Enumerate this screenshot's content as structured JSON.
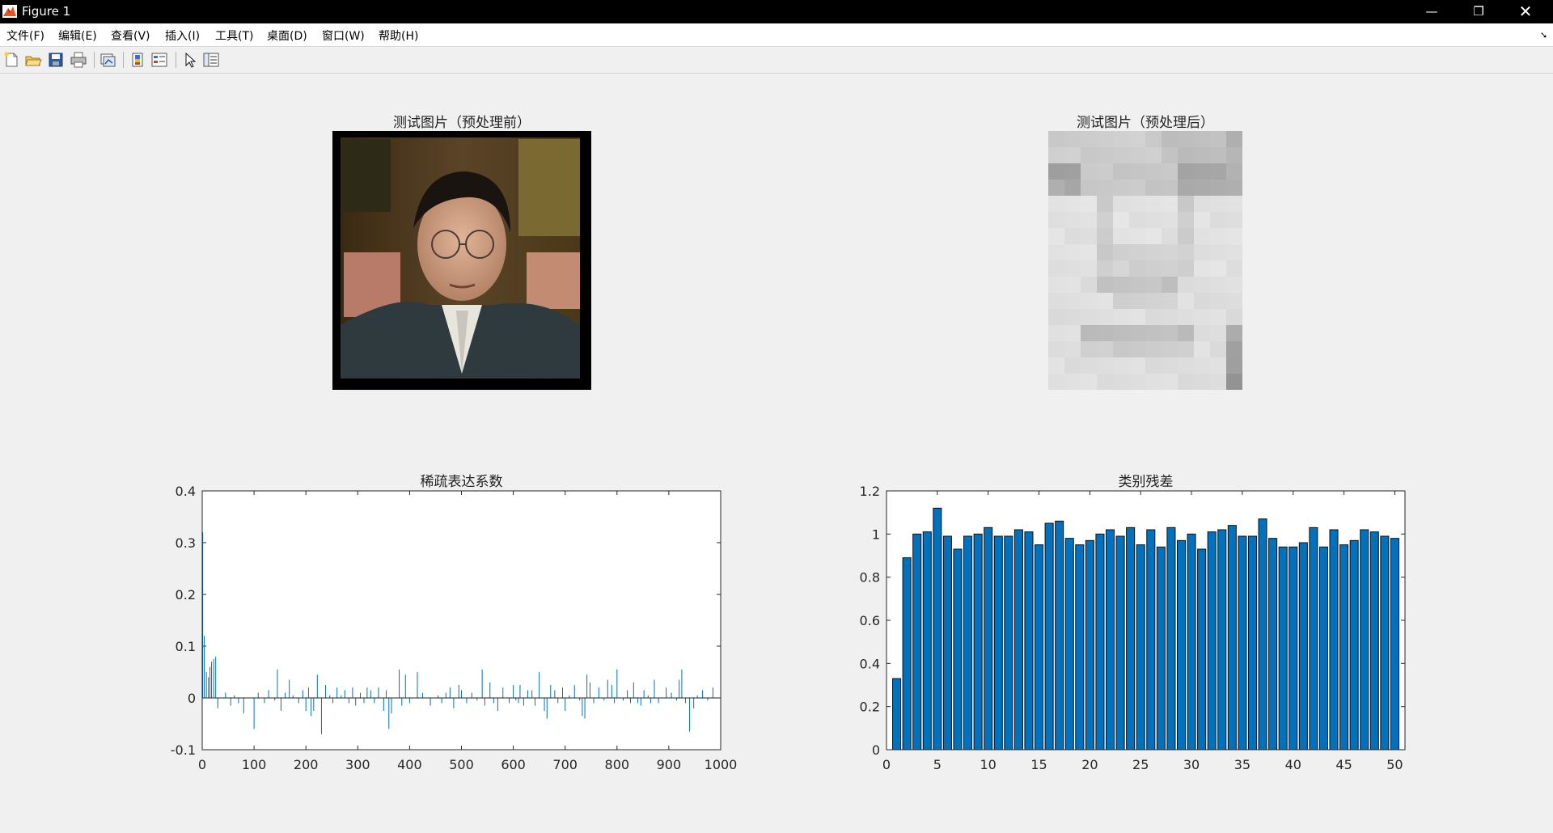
{
  "window": {
    "title": "Figure 1"
  },
  "menu": [
    "文件(F)",
    "编辑(E)",
    "查看(V)",
    "插入(I)",
    "工具(T)",
    "桌面(D)",
    "窗口(W)",
    "帮助(H)"
  ],
  "toolbar_icons": [
    "new-figure-icon",
    "open-file-icon",
    "save-icon",
    "print-icon",
    "link-plot-icon",
    "colorbar-icon",
    "legend-icon",
    "edit-plot-icon",
    "property-inspector-icon"
  ],
  "images": {
    "before_title": "测试图片（预处理前）",
    "after_title": "测试图片（预处理后）"
  },
  "chart_data": [
    {
      "type": "bar",
      "title": "稀疏表达系数",
      "xlabel": "",
      "ylabel": "",
      "xlim": [
        0,
        1000
      ],
      "ylim": [
        -0.1,
        0.4
      ],
      "xticks": [
        "0",
        "100",
        "200",
        "300",
        "400",
        "500",
        "600",
        "700",
        "800",
        "900",
        "1000"
      ],
      "yticks": [
        "-0.1",
        "0",
        "0.1",
        "0.2",
        "0.3",
        "0.4"
      ],
      "color": "#0072bd",
      "x": [
        1,
        4,
        8,
        12,
        15,
        18,
        22,
        26,
        30,
        45,
        55,
        62,
        70,
        80,
        100,
        108,
        120,
        128,
        140,
        145,
        152,
        160,
        168,
        175,
        186,
        194,
        200,
        205,
        210,
        215,
        222,
        230,
        238,
        246,
        252,
        260,
        268,
        275,
        283,
        290,
        296,
        305,
        312,
        318,
        325,
        332,
        340,
        350,
        355,
        360,
        365,
        380,
        385,
        392,
        400,
        415,
        425,
        440,
        455,
        462,
        470,
        478,
        485,
        495,
        500,
        510,
        520,
        530,
        540,
        545,
        555,
        562,
        570,
        580,
        592,
        600,
        605,
        610,
        613,
        620,
        628,
        636,
        642,
        650,
        660,
        665,
        672,
        680,
        686,
        695,
        700,
        708,
        718,
        728,
        733,
        738,
        742,
        748,
        755,
        765,
        775,
        782,
        790,
        795,
        800,
        812,
        820,
        826,
        832,
        840,
        846,
        852,
        860,
        865,
        872,
        880,
        895,
        905,
        915,
        920,
        925,
        932,
        940,
        948,
        955,
        965,
        975,
        985
      ],
      "values": [
        0.32,
        0.12,
        0.05,
        0.04,
        0.06,
        0.07,
        0.075,
        0.08,
        -0.02,
        0.01,
        -0.015,
        0.005,
        -0.01,
        -0.03,
        -0.06,
        0.01,
        -0.01,
        0.015,
        -0.005,
        0.055,
        -0.025,
        0.01,
        0.035,
        0.005,
        -0.01,
        0.015,
        -0.025,
        0.02,
        -0.035,
        -0.025,
        0.045,
        -0.07,
        0.025,
        0.005,
        -0.01,
        0.02,
        0.005,
        0.015,
        -0.01,
        0.02,
        -0.015,
        0.01,
        -0.01,
        0.02,
        0.015,
        -0.01,
        0.02,
        -0.025,
        0.015,
        -0.06,
        -0.03,
        0.055,
        -0.015,
        0.045,
        -0.01,
        0.05,
        0.01,
        -0.015,
        0.005,
        -0.01,
        0.01,
        0.02,
        -0.02,
        0.025,
        0.015,
        -0.01,
        0.01,
        -0.005,
        0.055,
        -0.015,
        0.03,
        -0.01,
        -0.025,
        0.02,
        -0.01,
        0.025,
        -0.005,
        -0.01,
        0.025,
        -0.015,
        0.015,
        0.015,
        -0.015,
        0.05,
        -0.025,
        -0.04,
        0.025,
        0.015,
        -0.01,
        0.02,
        -0.025,
        0.005,
        0.025,
        -0.005,
        -0.035,
        -0.04,
        0.045,
        0.03,
        -0.01,
        0.02,
        -0.005,
        0.035,
        0.025,
        -0.01,
        0.055,
        -0.005,
        0.015,
        -0.01,
        0.03,
        -0.01,
        -0.015,
        0.015,
        0.005,
        -0.01,
        0.035,
        -0.01,
        0.02,
        0.01,
        -0.005,
        0.035,
        0.055,
        -0.01,
        -0.065,
        -0.02,
        0.005,
        0.015,
        -0.005,
        0.02
      ]
    },
    {
      "type": "bar",
      "title": "类别残差",
      "xlabel": "",
      "ylabel": "",
      "xlim": [
        0,
        51
      ],
      "ylim": [
        0,
        1.2
      ],
      "xticks": [
        "0",
        "5",
        "10",
        "15",
        "20",
        "25",
        "30",
        "35",
        "40",
        "45",
        "50"
      ],
      "yticks": [
        "0",
        "0.2",
        "0.4",
        "0.6",
        "0.8",
        "1",
        "1.2"
      ],
      "color": "#0072bd",
      "categories": [
        1,
        2,
        3,
        4,
        5,
        6,
        7,
        8,
        9,
        10,
        11,
        12,
        13,
        14,
        15,
        16,
        17,
        18,
        19,
        20,
        21,
        22,
        23,
        24,
        25,
        26,
        27,
        28,
        29,
        30,
        31,
        32,
        33,
        34,
        35,
        36,
        37,
        38,
        39,
        40,
        41,
        42,
        43,
        44,
        45,
        46,
        47,
        48,
        49,
        50
      ],
      "values": [
        0.33,
        0.89,
        1.0,
        1.01,
        1.12,
        0.99,
        0.93,
        0.99,
        1.0,
        1.03,
        0.99,
        0.99,
        1.02,
        1.01,
        0.95,
        1.05,
        1.06,
        0.98,
        0.95,
        0.97,
        1.0,
        1.02,
        0.99,
        1.03,
        0.95,
        1.02,
        0.94,
        1.03,
        0.97,
        1.0,
        0.93,
        1.01,
        1.02,
        1.04,
        0.99,
        0.99,
        1.07,
        0.98,
        0.94,
        0.94,
        0.96,
        1.03,
        0.94,
        1.02,
        0.95,
        0.97,
        1.02,
        1.01,
        0.99,
        0.98
      ]
    }
  ]
}
